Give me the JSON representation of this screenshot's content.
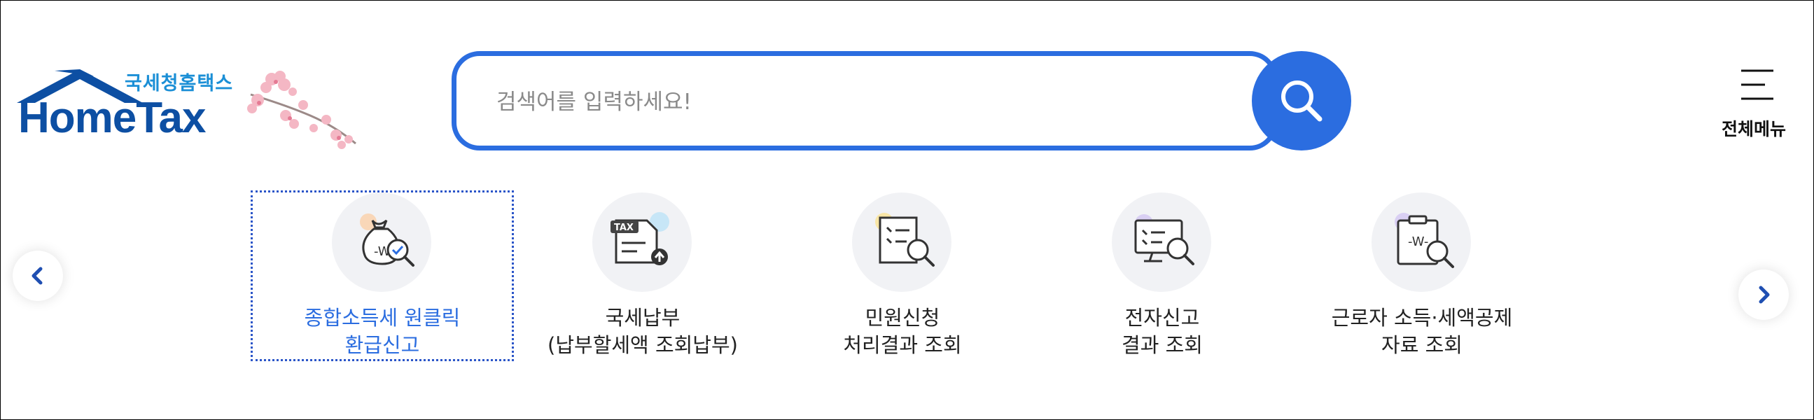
{
  "brand": {
    "sub": "국세청홈택스",
    "main": "HomeTax"
  },
  "search": {
    "placeholder": "검색어를 입력하세요!",
    "value": ""
  },
  "header": {
    "all_menu_label": "전체메뉴"
  },
  "quick_menu": [
    {
      "line1": "종합소득세 원클릭",
      "line2": "환급신고",
      "active": true
    },
    {
      "line1": "국세납부",
      "line2": "(납부할세액 조회납부)",
      "active": false
    },
    {
      "line1": "민원신청",
      "line2": "처리결과 조회",
      "active": false
    },
    {
      "line1": "전자신고",
      "line2": "결과 조회",
      "active": false
    },
    {
      "line1": "근로자 소득·세액공제",
      "line2": "자료 조회",
      "active": false
    }
  ],
  "icons": {
    "logo_house": "house-logo-icon",
    "blossom": "cherry-blossom-icon",
    "search": "search-icon",
    "menu": "hamburger-icon",
    "prev": "chevron-left-icon",
    "next": "chevron-right-icon"
  },
  "colors": {
    "accent": "#2b6de0",
    "brand_dark": "#0d4fa3",
    "brand_light": "#1b8fd6",
    "icon_bg": "#f1f2f5"
  }
}
